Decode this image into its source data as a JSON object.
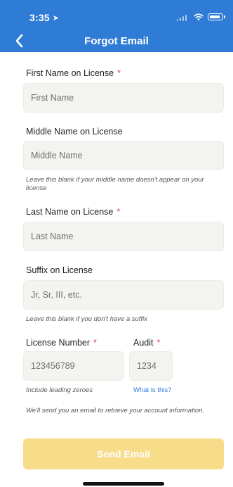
{
  "status_bar": {
    "time": "3:35",
    "location_glyph": "➤"
  },
  "nav": {
    "title": "Forgot Email",
    "back_icon": "chevron-left-icon"
  },
  "form": {
    "first_name": {
      "label": "First Name on License",
      "required_mark": "*",
      "placeholder": "First Name",
      "value": ""
    },
    "middle_name": {
      "label": "Middle Name on License",
      "placeholder": "Middle Name",
      "value": "",
      "help": "Leave this blank if your middle name doesn't appear on your license"
    },
    "last_name": {
      "label": "Last Name on License",
      "required_mark": "*",
      "placeholder": "Last Name",
      "value": ""
    },
    "suffix": {
      "label": "Suffix on License",
      "placeholder": "Jr, Sr, III, etc.",
      "value": "",
      "help": "Leave this blank if you don't have a suffix"
    },
    "license_number": {
      "label": "License Number",
      "required_mark": "*",
      "placeholder": "123456789",
      "value": "",
      "help": "Include leading zeroes"
    },
    "audit": {
      "label": "Audit",
      "required_mark": "*",
      "placeholder": "1234",
      "value": "",
      "link": "What is this?"
    },
    "info_text": "We'll send you an email to retrieve your account information.",
    "submit_label": "Send Email"
  },
  "colors": {
    "header": "#2f7cd6",
    "required": "#e0484b",
    "button_disabled": "#f7dc8a",
    "link": "#2f7cd6"
  }
}
